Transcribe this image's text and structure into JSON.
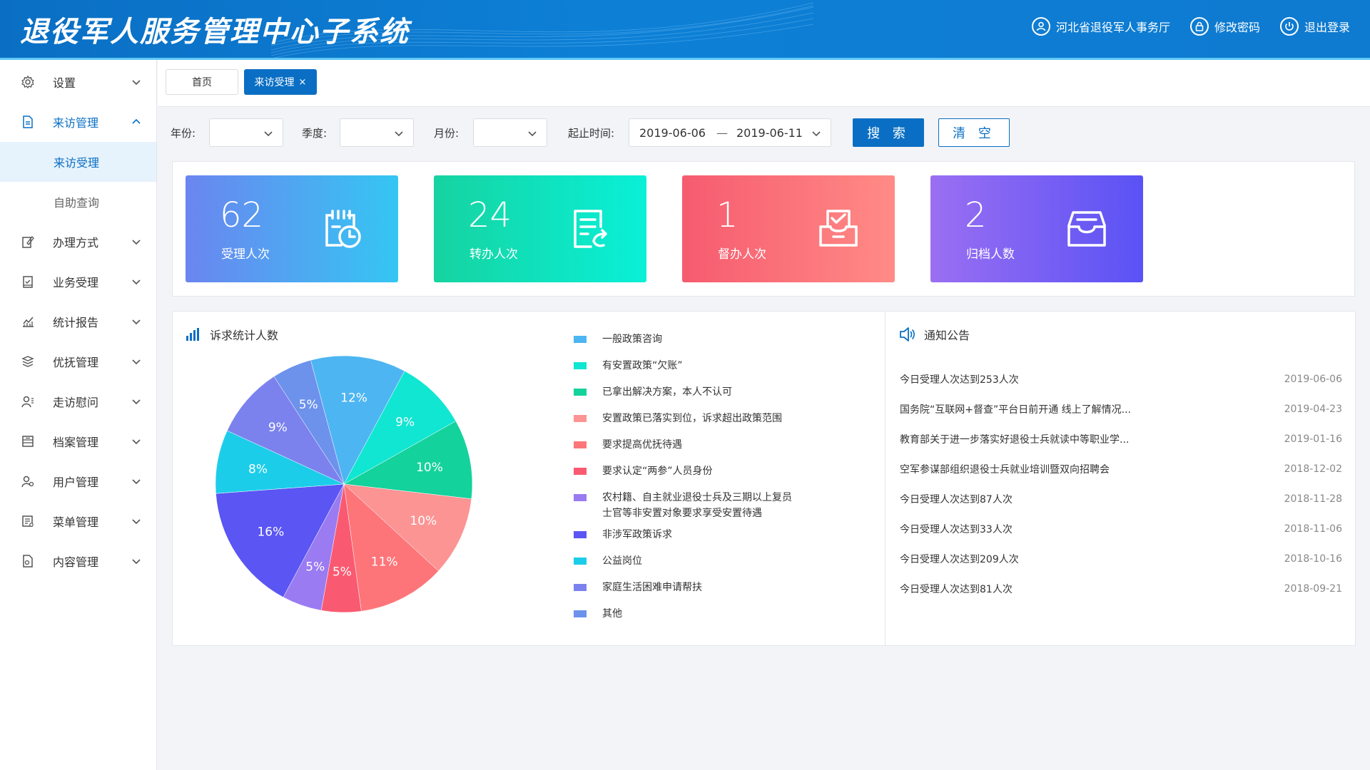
{
  "header": {
    "title": "退役军人服务管理中心子系统",
    "actions": [
      {
        "label": "河北省退役军人事务厅",
        "icon": "user-icon"
      },
      {
        "label": "修改密码",
        "icon": "lock-icon"
      },
      {
        "label": "退出登录",
        "icon": "power-icon"
      }
    ]
  },
  "sidebar": {
    "items": [
      {
        "label": "设置",
        "icon": "gear-icon"
      },
      {
        "label": "来访管理",
        "icon": "document-icon",
        "expanded": true
      },
      {
        "label": "办理方式",
        "icon": "edit-icon"
      },
      {
        "label": "业务受理",
        "icon": "clipboard-icon"
      },
      {
        "label": "统计报告",
        "icon": "chart-icon"
      },
      {
        "label": "优抚管理",
        "icon": "layers-icon"
      },
      {
        "label": "走访慰问",
        "icon": "person-icon"
      },
      {
        "label": "档案管理",
        "icon": "archive-icon"
      },
      {
        "label": "用户管理",
        "icon": "users-icon"
      },
      {
        "label": "菜单管理",
        "icon": "menu-icon"
      },
      {
        "label": "内容管理",
        "icon": "content-icon"
      }
    ],
    "submenu": [
      {
        "label": "来访受理",
        "active": true
      },
      {
        "label": "自助查询",
        "active": false
      }
    ]
  },
  "tabs": [
    {
      "label": "首页",
      "active": false
    },
    {
      "label": "来访受理",
      "active": true,
      "close": "×"
    }
  ],
  "filters": {
    "year_label": "年份:",
    "quarter_label": "季度:",
    "month_label": "月份:",
    "range_label": "起止时间:",
    "start_date": "2019-06-06",
    "range_sep": "—",
    "end_date": "2019-06-11",
    "search_label": "搜 索",
    "clear_label": "清 空"
  },
  "stats": [
    {
      "value": "62",
      "label": "受理人次",
      "icon": "calendar-clock-icon",
      "gradient": [
        "#6b85f0",
        "#35c6f2"
      ]
    },
    {
      "value": "24",
      "label": "转办人次",
      "icon": "document-transfer-icon",
      "gradient": [
        "#16d3a0",
        "#09f0d8"
      ]
    },
    {
      "value": "1",
      "label": "督办人次",
      "icon": "supervise-icon",
      "gradient": [
        "#f65b6f",
        "#ff8b86"
      ]
    },
    {
      "value": "2",
      "label": "归档人数",
      "icon": "inbox-icon",
      "gradient": [
        "#9a6ff2",
        "#5a52f5"
      ]
    }
  ],
  "chart_panel": {
    "title": "诉求统计人数",
    "icon": "bar-chart-icon"
  },
  "chart_data": {
    "type": "pie",
    "title": "",
    "series": [
      {
        "name": "一般政策咨询",
        "value": 12,
        "label": "12%",
        "color": "#4db5f2"
      },
      {
        "name": "有安置政策“欠账”",
        "value": 9,
        "label": "9%",
        "color": "#10e6d2"
      },
      {
        "name": "已拿出解决方案，本人不认可",
        "value": 10,
        "label": "10%",
        "color": "#14d29c"
      },
      {
        "name": "安置政策已落实到位，诉求超出政策范围",
        "value": 10,
        "label": "10%",
        "color": "#fc9494"
      },
      {
        "name": "要求提高优抚待遇",
        "value": 11,
        "label": "11%",
        "color": "#fd7579"
      },
      {
        "name": "要求认定“两参”人员身份",
        "value": 5,
        "label": "5%",
        "color": "#fa5a71"
      },
      {
        "name": "农村籍、自主就业退役士兵及三期以上复员士官等非安置对象要求享受安置待遇",
        "value": 5,
        "label": "5%",
        "color": "#9a7bf2"
      },
      {
        "name": "非涉军政策诉求",
        "value": 16,
        "label": "16%",
        "color": "#5a55f3"
      },
      {
        "name": "公益岗位",
        "value": 8,
        "label": "8%",
        "color": "#1ccdea"
      },
      {
        "name": "家庭生活困难申请帮扶",
        "value": 9,
        "label": "9%",
        "color": "#7b82ee"
      },
      {
        "name": "其他",
        "value": 5,
        "label": "5%",
        "color": "#6c92ec"
      }
    ],
    "legend_position": "right",
    "legend_lines": [
      [
        "一般政策咨询"
      ],
      [
        "有安置政策“欠账”"
      ],
      [
        "已拿出解决方案，本人不认可"
      ],
      [
        "安置政策已落实到位，诉求超出政策范围"
      ],
      [
        "要求提高优抚待遇"
      ],
      [
        "要求认定“两参”人员身份"
      ],
      [
        "农村籍、自主就业退役士兵及三期以上复员",
        "士官等非安置对象要求享受安置待遇"
      ],
      [
        "非涉军政策诉求"
      ],
      [
        "公益岗位"
      ],
      [
        "家庭生活困难申请帮扶"
      ],
      [
        "其他"
      ]
    ]
  },
  "notice_panel": {
    "title": "通知公告",
    "icon": "speaker-icon",
    "items": [
      {
        "title": "今日受理人次达到253人次",
        "date": "2019-06-06"
      },
      {
        "title": "国务院“互联网+督查”平台日前开通 线上了解情况...",
        "date": "2019-04-23"
      },
      {
        "title": "教育部关于进一步落实好退役士兵就读中等职业学...",
        "date": "2019-01-16"
      },
      {
        "title": "空军参谋部组织退役士兵就业培训暨双向招聘会",
        "date": "2018-12-02"
      },
      {
        "title": "今日受理人次达到87人次",
        "date": "2018-11-28"
      },
      {
        "title": "今日受理人次达到33人次",
        "date": "2018-11-06"
      },
      {
        "title": "今日受理人次达到209人次",
        "date": "2018-10-16"
      },
      {
        "title": "今日受理人次达到81人次",
        "date": "2018-09-21"
      }
    ]
  }
}
